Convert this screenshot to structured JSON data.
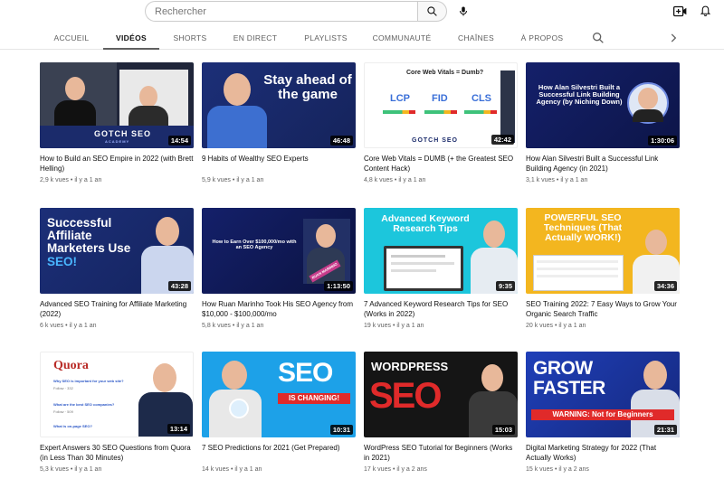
{
  "topbar": {
    "search_placeholder": "Rechercher",
    "icons": {
      "search": "search-icon",
      "mic": "microphone-icon",
      "create": "create-video-icon",
      "bell": "bell-icon"
    }
  },
  "tabs": [
    {
      "label": "ACCUEIL",
      "active": false
    },
    {
      "label": "VIDÉOS",
      "active": true
    },
    {
      "label": "SHORTS",
      "active": false
    },
    {
      "label": "EN DIRECT",
      "active": false
    },
    {
      "label": "PLAYLISTS",
      "active": false
    },
    {
      "label": "COMMUNAUTÉ",
      "active": false
    },
    {
      "label": "CHAÎNES",
      "active": false
    },
    {
      "label": "À PROPOS",
      "active": false
    }
  ],
  "videos": [
    {
      "title": "How to Build an SEO Empire in 2022 (with Brett Helling)",
      "views": "2,9 k vues",
      "age": "il y a 1 an",
      "duration": "14:54",
      "thumb": {
        "brand": "GOTCH SEO",
        "sub": "ACADEMY"
      }
    },
    {
      "title": "9 Habits of Wealthy SEO Experts",
      "views": "5,9 k vues",
      "age": "il y a 1 an",
      "duration": "46:48",
      "thumb": {
        "text": "Stay ahead of the game"
      }
    },
    {
      "title": "Core Web Vitals = DUMB (+ the Greatest SEO Content Hack)",
      "views": "4,8 k vues",
      "age": "il y a 1 an",
      "duration": "42:42",
      "thumb": {
        "text": "Core Web Vitals = Dumb?",
        "metrics": [
          "LCP",
          "FID",
          "CLS"
        ],
        "brand": "GOTCH SEO"
      }
    },
    {
      "title": "How Alan Silvestri Built a Successful Link Building Agency (in 2021)",
      "views": "3,1 k vues",
      "age": "il y a 1 an",
      "duration": "1:30:06",
      "thumb": {
        "text": "How Alan Silvestri Built a Successful Link Building Agency (by Niching Down)"
      }
    },
    {
      "title": "Advanced SEO Training for Affiliate Marketing (2022)",
      "views": "6 k vues",
      "age": "il y a 1 an",
      "duration": "43:28",
      "thumb": {
        "text": "Successful Affiliate Marketers Use",
        "accent": "SEO!"
      }
    },
    {
      "title": "How Ruan Marinho Took His SEO Agency from $10,000 - $100,000/mo",
      "views": "5,8 k vues",
      "age": "il y a 1 an",
      "duration": "1:13:50",
      "thumb": {
        "text": "How to Earn Over $100,000/mo with an SEO Agency",
        "badge": "RUAN MARINHO"
      }
    },
    {
      "title": "7 Advanced Keyword Research Tips for SEO (Works in 2022)",
      "views": "19 k vues",
      "age": "il y a 1 an",
      "duration": "9:35",
      "thumb": {
        "text": "Advanced Keyword Research Tips"
      }
    },
    {
      "title": "SEO Training 2022: 7 Easy Ways to Grow Your Organic Search Traffic",
      "views": "20 k vues",
      "age": "il y a 1 an",
      "duration": "34:36",
      "thumb": {
        "text": "POWERFUL SEO Techniques (That Actually WORK!)"
      }
    },
    {
      "title": "Expert Answers 30 SEO Questions from Quora (in Less Than 30 Minutes)",
      "views": "5,3 k vues",
      "age": "il y a 1 an",
      "duration": "13:14",
      "thumb": {
        "brand": "Quora",
        "questions": [
          "Why SEO is important for your web site?",
          "What are the best SEO companies?",
          "What is on-page SEO?"
        ],
        "follow": "Follow",
        "counts": [
          "332",
          "509"
        ]
      }
    },
    {
      "title": "7 SEO Predictions for 2021 (Get Prepared)",
      "views": "14 k vues",
      "age": "il y a 1 an",
      "duration": "10:31",
      "thumb": {
        "text": "SEO",
        "banner": "IS CHANGING!"
      }
    },
    {
      "title": "WordPress SEO Tutorial for Beginners (Works in 2021)",
      "views": "17 k vues",
      "age": "il y a 2 ans",
      "duration": "15:03",
      "thumb": {
        "text": "WORDPRESS",
        "big": "SEO"
      }
    },
    {
      "title": "Digital Marketing Strategy for 2022 (That Actually Works)",
      "views": "15 k vues",
      "age": "il y a 2 ans",
      "duration": "21:31",
      "thumb": {
        "text": "GROW FASTER",
        "banner": "WARNING: Not for Beginners"
      }
    }
  ],
  "colors": {
    "navy": "#1b2b6b",
    "royal": "#1f3fb8",
    "cyan": "#1cc6dc",
    "yellow": "#f3b61f",
    "red": "#e02a2a",
    "green": "#3ec27a"
  }
}
